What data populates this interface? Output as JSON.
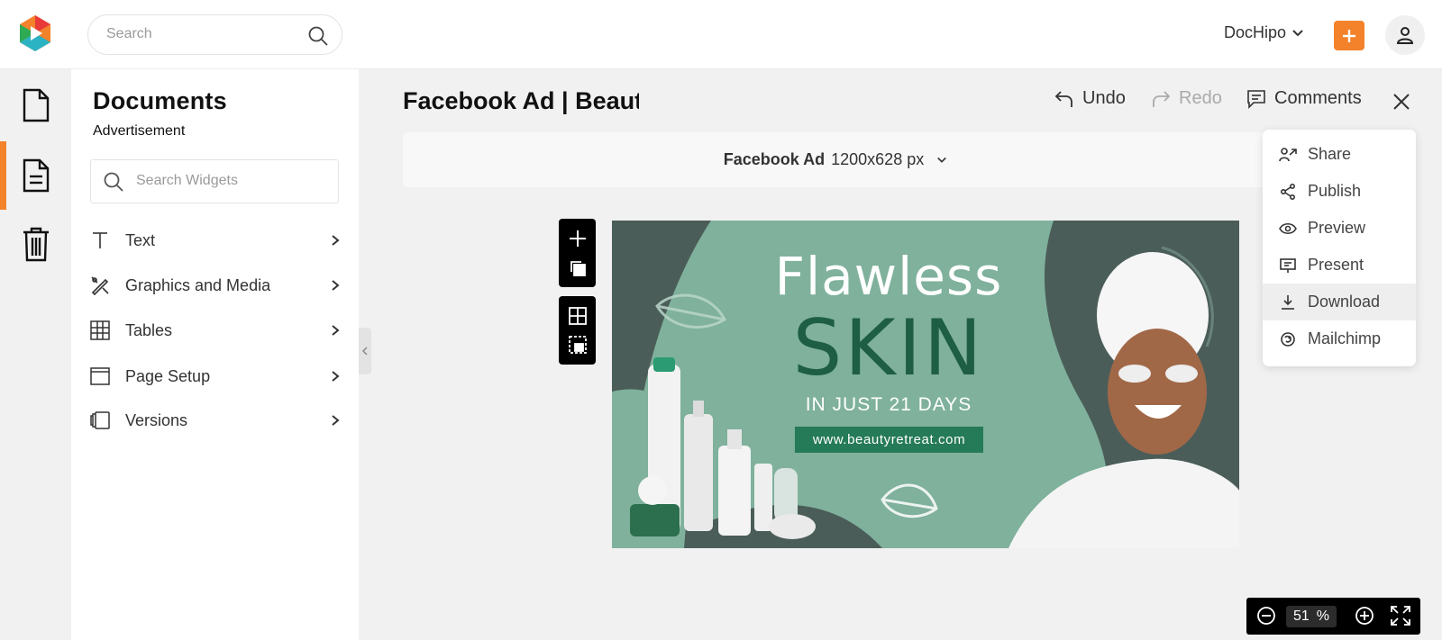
{
  "search": {
    "placeholder": "Search"
  },
  "header": {
    "brand_menu": "DocHipo",
    "add_icon": "plus-icon",
    "avatar_icon": "user-icon"
  },
  "rail": {
    "items": [
      "document-icon",
      "document-lines-icon",
      "trash-icon"
    ],
    "active_index": 1,
    "accent": "#f3822b"
  },
  "panel": {
    "title": "Documents",
    "subtitle": "Advertisement",
    "search_placeholder": "Search Widgets",
    "items": [
      {
        "label": "Text",
        "icon": "text-icon"
      },
      {
        "label": "Graphics and Media",
        "icon": "graphics-icon"
      },
      {
        "label": "Tables",
        "icon": "table-icon"
      },
      {
        "label": "Page Setup",
        "icon": "page-setup-icon"
      },
      {
        "label": "Versions",
        "icon": "versions-icon"
      }
    ]
  },
  "doc": {
    "title": "Facebook Ad | Beauty",
    "undo": "Undo",
    "redo": "Redo",
    "comments": "Comments"
  },
  "sizebar": {
    "name": "Facebook Ad",
    "size": "1200x628 px"
  },
  "ad": {
    "headline1": "Flawless",
    "headline2": "SKIN",
    "line3": "IN JUST 21 DAYS",
    "url": "www.beautyretreat.com"
  },
  "dropdown": {
    "items": [
      {
        "label": "Share",
        "icon": "share-icon"
      },
      {
        "label": "Publish",
        "icon": "publish-icon"
      },
      {
        "label": "Preview",
        "icon": "eye-icon"
      },
      {
        "label": "Present",
        "icon": "present-icon"
      },
      {
        "label": "Download",
        "icon": "download-icon",
        "highlighted": true
      },
      {
        "label": "Mailchimp",
        "icon": "mailchimp-icon"
      }
    ]
  },
  "zoom": {
    "value": "51",
    "unit": "%"
  }
}
